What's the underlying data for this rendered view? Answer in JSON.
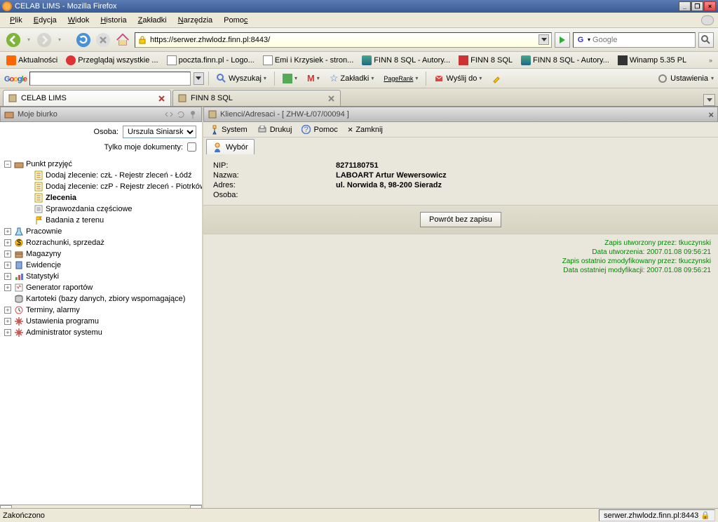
{
  "window": {
    "title": "CELAB LIMS - Mozilla Firefox"
  },
  "menubar": [
    "Plik",
    "Edycja",
    "Widok",
    "Historia",
    "Zakładki",
    "Narzędzia",
    "Pomoc"
  ],
  "url": "https://serwer.zhwlodz.finn.pl:8443/",
  "search_placeholder": "Google",
  "bookmarks": [
    {
      "label": "Aktualności",
      "icon": "rss"
    },
    {
      "label": "Przeglądaj wszystkie ...",
      "icon": "lady"
    },
    {
      "label": "poczta.finn.pl - Logo...",
      "icon": "page"
    },
    {
      "label": "Emi i Krzysiek - stron...",
      "icon": "page"
    },
    {
      "label": "FINN 8 SQL - Autory...",
      "icon": "bank"
    },
    {
      "label": "FINN 8 SQL",
      "icon": "red"
    },
    {
      "label": "FINN 8 SQL - Autory...",
      "icon": "bank"
    },
    {
      "label": "Winamp 5.35 PL",
      "icon": "winamp"
    }
  ],
  "gtoolbar": {
    "wyszukaj": "Wyszukaj",
    "zakladki": "Zakładki",
    "pagerank": "PageRank",
    "wyslij": "Wyślij do",
    "ustawienia": "Ustawienia"
  },
  "tabs": [
    {
      "label": "CELAB LIMS",
      "active": true
    },
    {
      "label": "FINN 8 SQL",
      "active": false
    }
  ],
  "leftpane": {
    "title": "Moje biurko",
    "osoba_label": "Osoba:",
    "osoba_value": "Urszula Siniarska",
    "tylko_label": "Tylko moje dokumenty:",
    "tree": [
      {
        "exp": "-",
        "indent": 0,
        "icon": "desk",
        "label": "Punkt przyjęć",
        "bold": false
      },
      {
        "exp": "",
        "indent": 2,
        "icon": "form",
        "label": "Dodaj zlecenie: czŁ - Rejestr zleceń - Łódź"
      },
      {
        "exp": "",
        "indent": 2,
        "icon": "form",
        "label": "Dodaj zlecenie: czP - Rejestr zleceń - Piotrków"
      },
      {
        "exp": "",
        "indent": 2,
        "icon": "form",
        "label": "Zlecenia",
        "bold": true
      },
      {
        "exp": "",
        "indent": 2,
        "icon": "list",
        "label": "Sprawozdania częściowe"
      },
      {
        "exp": "",
        "indent": 2,
        "icon": "flag",
        "label": "Badania z terenu"
      },
      {
        "exp": "+",
        "indent": 0,
        "icon": "lab",
        "label": "Pracownie"
      },
      {
        "exp": "+",
        "indent": 0,
        "icon": "money",
        "label": "Rozrachunki, sprzedaż"
      },
      {
        "exp": "+",
        "indent": 0,
        "icon": "box",
        "label": "Magazyny"
      },
      {
        "exp": "+",
        "indent": 0,
        "icon": "book",
        "label": "Ewidencje"
      },
      {
        "exp": "+",
        "indent": 0,
        "icon": "chart",
        "label": "Statystyki"
      },
      {
        "exp": "+",
        "indent": 0,
        "icon": "report",
        "label": "Generator raportów"
      },
      {
        "exp": "",
        "indent": 0,
        "icon": "db",
        "label": "Kartoteki (bazy danych, zbiory wspomagające)"
      },
      {
        "exp": "+",
        "indent": 0,
        "icon": "clock",
        "label": "Terminy, alarmy"
      },
      {
        "exp": "+",
        "indent": 0,
        "icon": "gear",
        "label": "Ustawienia programu"
      },
      {
        "exp": "+",
        "indent": 0,
        "icon": "gear",
        "label": "Administrator systemu"
      }
    ]
  },
  "rightpane": {
    "title": "Klienci/Adresaci - [ ZHW-Ł/07/00094 ]",
    "menu": {
      "system": "System",
      "drukuj": "Drukuj",
      "pomoc": "Pomoc",
      "zamknij": "Zamknij"
    },
    "tab": "Wybór",
    "fields": [
      {
        "label": "NIP:",
        "value": "8271180751"
      },
      {
        "label": "Nazwa:",
        "value": "LABOART Artur Wewersowicz"
      },
      {
        "label": "Adres:",
        "value": "ul. Norwida 8, 98-200 Sieradz"
      },
      {
        "label": "Osoba:",
        "value": ""
      }
    ],
    "return_btn": "Powrót bez zapisu",
    "audit": [
      "Zapis utworzony przez: tkuczynski",
      "Data utworzenia: 2007.01.08 09:56:21",
      "Zapis ostatnio zmodyfikowany przez: tkuczynski",
      "Data ostatniej modyfikacji: 2007.01.08 09:56:21"
    ]
  },
  "status": {
    "left": "Zakończono",
    "right": "serwer.zhwlodz.finn.pl:8443"
  }
}
